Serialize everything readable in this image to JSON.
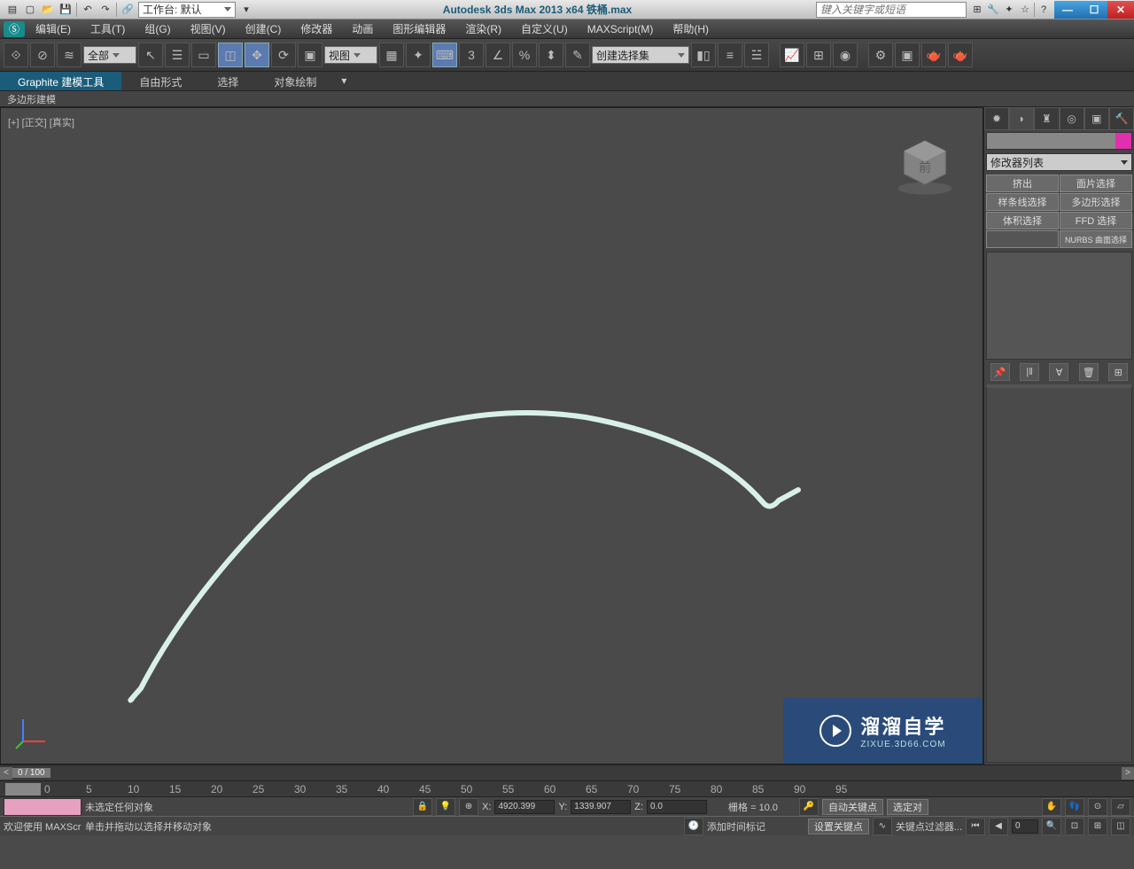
{
  "titlebar": {
    "workspace_label": "工作台: 默认",
    "title": "Autodesk 3ds Max  2013 x64     铁桶.max",
    "search_placeholder": "键入关键字或短语"
  },
  "menubar": {
    "items": [
      "编辑(E)",
      "工具(T)",
      "组(G)",
      "视图(V)",
      "创建(C)",
      "修改器",
      "动画",
      "图形编辑器",
      "渲染(R)",
      "自定义(U)",
      "MAXScript(M)",
      "帮助(H)"
    ]
  },
  "toolbar": {
    "filter_dd": "全部",
    "view_dd": "视图",
    "selset_dd": "创建选择集"
  },
  "ribbon": {
    "tabs": [
      "Graphite 建模工具",
      "自由形式",
      "选择",
      "对象绘制"
    ],
    "sub": "多边形建模"
  },
  "viewport": {
    "label": "[+] [正交] [真实]"
  },
  "cmdpanel": {
    "modifier_list": "修改器列表",
    "buttons": [
      "挤出",
      "面片选择",
      "样条线选择",
      "多边形选择",
      "体积选择",
      "FFD 选择"
    ],
    "nurbs_btn": "NURBS 曲面选择"
  },
  "timeline": {
    "label": "0 / 100",
    "ticks": [
      "0",
      "5",
      "10",
      "15",
      "20",
      "25",
      "30",
      "35",
      "40",
      "45",
      "50",
      "55",
      "60",
      "65",
      "70",
      "75",
      "80",
      "85",
      "90",
      "95"
    ]
  },
  "status": {
    "no_sel": "未选定任何对象",
    "x": "4920.399",
    "y": "1339.907",
    "z": "0.0",
    "grid": "栅格 = 10.0",
    "autokey": "自动关键点",
    "selected": "选定对",
    "welcome": "欢迎使用  MAXScr",
    "hint": "单击并拖动以选择并移动对象",
    "addmarker": "添加时间标记",
    "setkey": "设置关键点",
    "keyfilter": "关键点过滤器..."
  },
  "watermark": {
    "line1": "溜溜自学",
    "line2": "ZIXUE.3D66.COM"
  }
}
